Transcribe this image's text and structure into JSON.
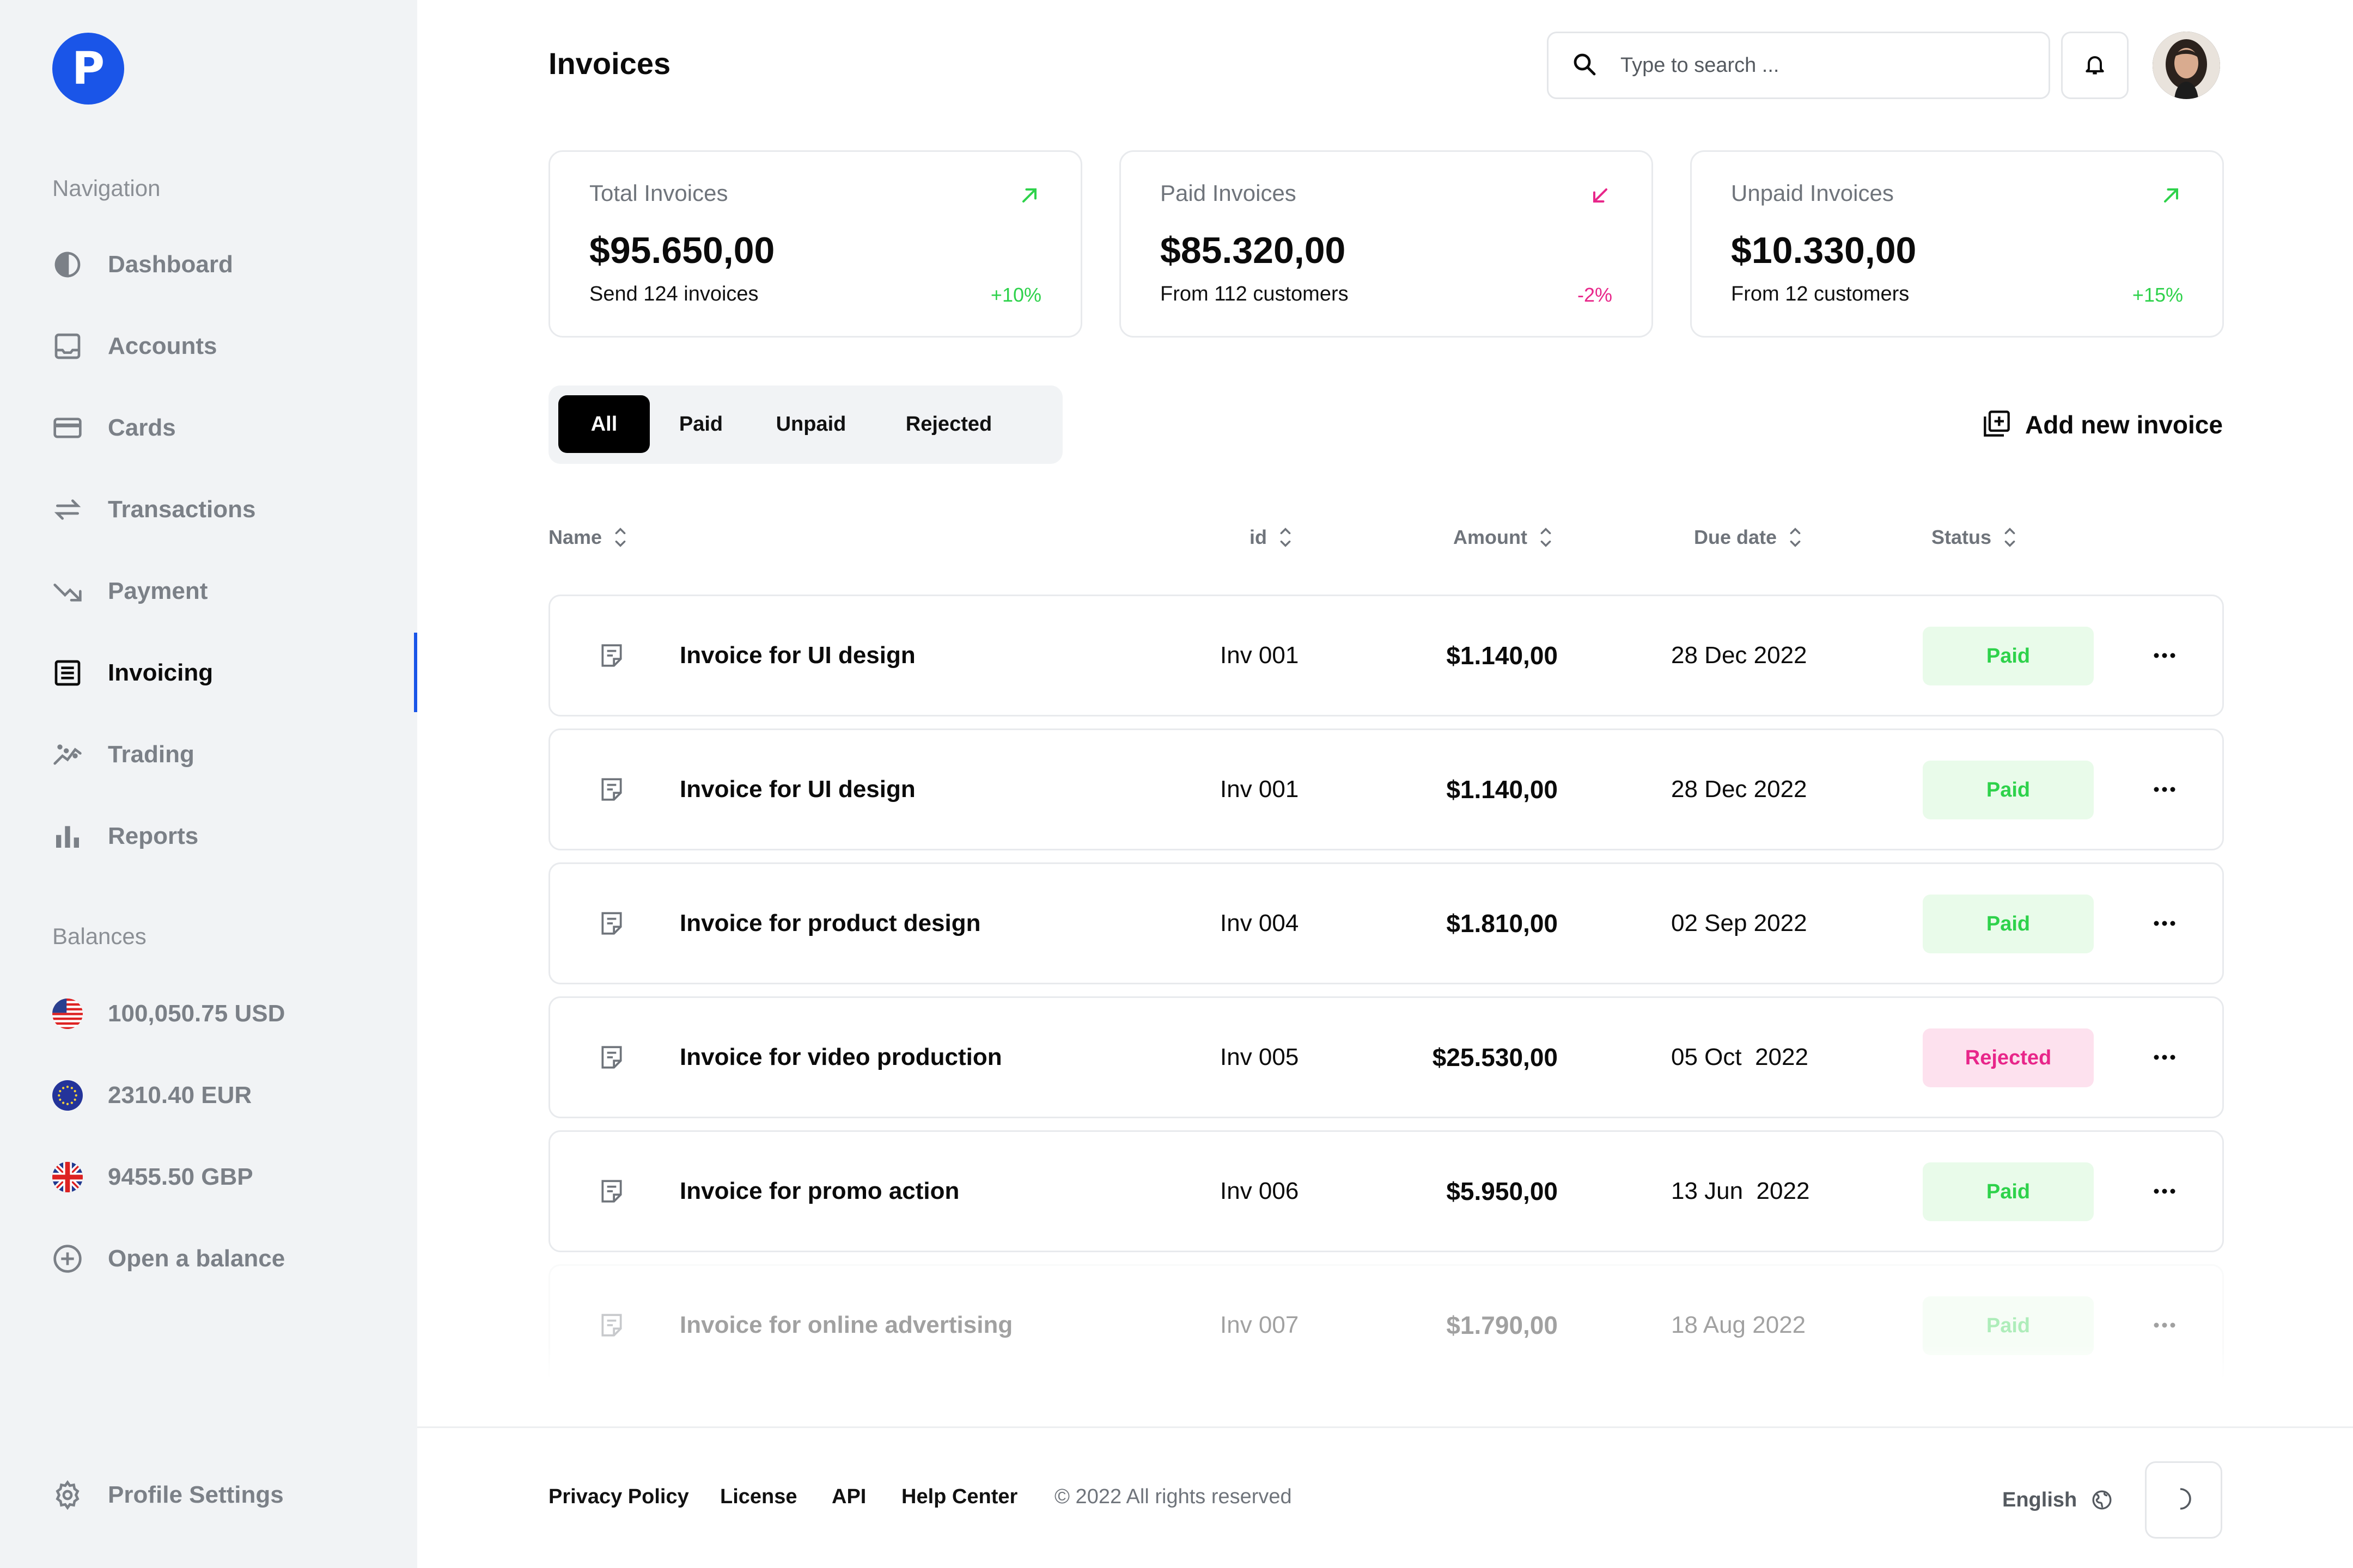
{
  "app": {
    "logo_letter": "P"
  },
  "sidebar": {
    "nav_heading": "Navigation",
    "items": [
      {
        "label": "Dashboard",
        "icon": "dashboard-icon"
      },
      {
        "label": "Accounts",
        "icon": "inbox-icon"
      },
      {
        "label": "Cards",
        "icon": "credit-card-icon"
      },
      {
        "label": "Transactions",
        "icon": "swap-arrows-icon"
      },
      {
        "label": "Payment",
        "icon": "payment-arrow-icon"
      },
      {
        "label": "Invoicing",
        "icon": "invoice-icon",
        "active": true
      },
      {
        "label": "Trading",
        "icon": "trending-icon"
      },
      {
        "label": "Reports",
        "icon": "bar-chart-icon"
      }
    ],
    "balances_heading": "Balances",
    "balances": [
      {
        "label": "100,050.75 USD",
        "icon": "us-flag-icon"
      },
      {
        "label": "2310.40 EUR",
        "icon": "eu-flag-icon"
      },
      {
        "label": "9455.50 GBP",
        "icon": "uk-flag-icon"
      }
    ],
    "open_balance": "Open a balance",
    "profile_settings": "Profile Settings"
  },
  "header": {
    "title": "Invoices",
    "search_placeholder": "Type to search ..."
  },
  "stats": [
    {
      "label": "Total Invoices",
      "value": "$95.650,00",
      "sub": "Send 124 invoices",
      "change": "+10%",
      "trend": "up",
      "color": "#2ed24b"
    },
    {
      "label": "Paid Invoices",
      "value": "$85.320,00",
      "sub": "From 112 customers",
      "change": "-2%",
      "trend": "down",
      "color": "#e8268a"
    },
    {
      "label": "Unpaid Invoices",
      "value": "$10.330,00",
      "sub": "From 12 customers",
      "change": "+15%",
      "trend": "up",
      "color": "#2ed24b"
    }
  ],
  "filters": {
    "tabs": [
      "All",
      "Paid",
      "Unpaid",
      "Rejected"
    ],
    "active": "All",
    "add_label": "Add new invoice"
  },
  "table": {
    "columns": [
      "Name",
      "id",
      "Amount",
      "Due date",
      "Status"
    ],
    "rows": [
      {
        "name": "Invoice for UI design",
        "id": "Inv 001",
        "amount": "$1.140,00",
        "due": "28 Dec 2022",
        "status": "Paid"
      },
      {
        "name": "Invoice for UI design",
        "id": "Inv 001",
        "amount": "$1.140,00",
        "due": "28 Dec 2022",
        "status": "Paid"
      },
      {
        "name": "Invoice for product design",
        "id": "Inv 004",
        "amount": "$1.810,00",
        "due": "02 Sep 2022",
        "status": "Paid"
      },
      {
        "name": "Invoice for video production",
        "id": "Inv 005",
        "amount": "$25.530,00",
        "due": "05 Oct  2022",
        "status": "Rejected"
      },
      {
        "name": "Invoice for promo action",
        "id": "Inv 006",
        "amount": "$5.950,00",
        "due": "13 Jun  2022",
        "status": "Paid"
      },
      {
        "name": "Invoice for online advertising",
        "id": "Inv 007",
        "amount": "$1.790,00",
        "due": "18 Aug 2022",
        "status": "Paid"
      }
    ]
  },
  "footer": {
    "links": [
      "Privacy Policy",
      "License",
      "API",
      "Help Center"
    ],
    "copyright": "© 2022 All rights reserved",
    "language": "English"
  },
  "colors": {
    "accent": "#1a55e8",
    "paid_text": "#2ed24b",
    "paid_bg": "#e9fbea",
    "rejected_text": "#e8268a",
    "rejected_bg": "#fde1ee"
  }
}
